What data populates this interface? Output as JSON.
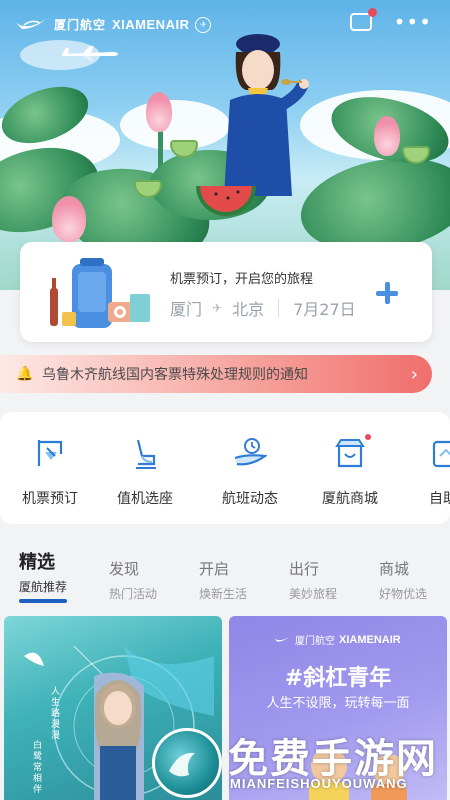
{
  "header": {
    "logo_cn": "厦门航空",
    "logo_en": "XIAMENAIR",
    "logo_seal": "✈",
    "more_icon": "more-dots-icon",
    "message_icon": "message-icon"
  },
  "booking": {
    "prompt": "机票预订，开启您的旅程",
    "from": "厦门",
    "to": "北京",
    "date": "7月27日"
  },
  "notice": {
    "text": "乌鲁木齐航线国内客票特殊处理规则的通知"
  },
  "quick_actions": [
    {
      "label": "机票预订",
      "icon": "flight-ticket-icon"
    },
    {
      "label": "值机选座",
      "icon": "seat-icon"
    },
    {
      "label": "航班动态",
      "icon": "flight-status-icon"
    },
    {
      "label": "厦航商城",
      "icon": "shop-icon"
    },
    {
      "label": "自助",
      "icon": "self-service-icon"
    }
  ],
  "tabs": [
    {
      "title": "精选",
      "sub": "厦航推荐"
    },
    {
      "title": "发现",
      "sub": "热门活动"
    },
    {
      "title": "开启",
      "sub": "焕新生活"
    },
    {
      "title": "出行",
      "sub": "美妙旅程"
    },
    {
      "title": "商城",
      "sub": "好物优选"
    }
  ],
  "feed": {
    "left_vertical_1": "人生路漫漫",
    "left_vertical_2": "白鹭常相伴",
    "right_logo_cn": "厦门航空",
    "right_logo_en": "XIAMENAIR",
    "right_title": "#斜杠青年",
    "right_sub": "人生不设限，玩转每一面"
  },
  "watermark": {
    "main": "免费手游网",
    "sub": "MIANFEISHOUYOUWANG"
  },
  "colors": {
    "accent": "#1f5fbf",
    "plus": "#4a8fe0",
    "badge": "#e84a5f"
  }
}
